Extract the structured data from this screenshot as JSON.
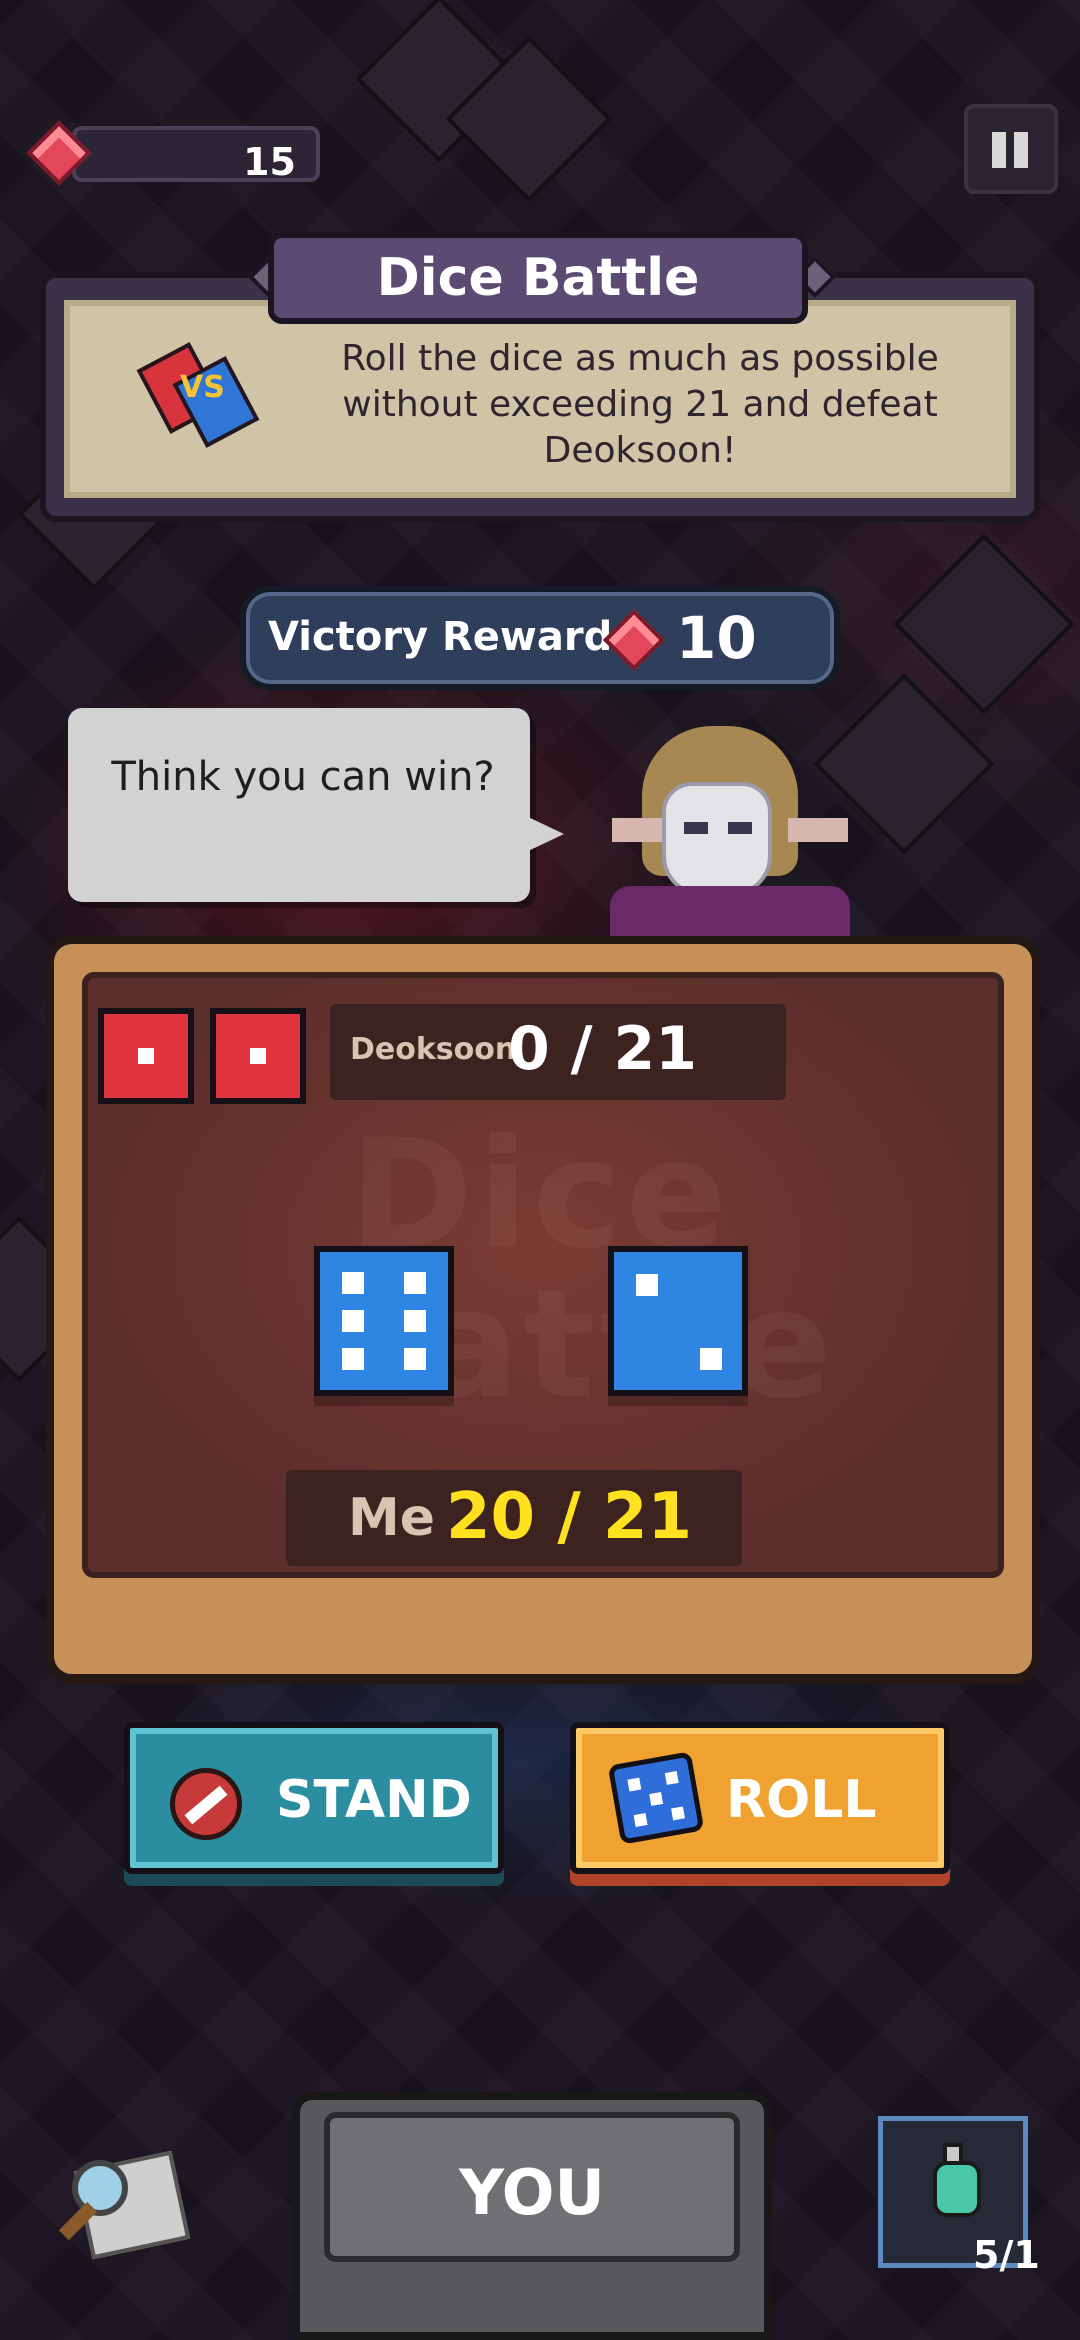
{
  "hud": {
    "gem_count": "15",
    "gem_icon": "red-gem-icon",
    "pause_icon": "pause-icon"
  },
  "panel": {
    "title": "Dice Battle",
    "description": "Roll the dice as much as possible without exceeding 21 and defeat Deoksoon!",
    "vs_icon": "vs-cards-icon"
  },
  "reward": {
    "label": "Victory Reward",
    "value": "10"
  },
  "opponent": {
    "speech": "Think you can win?",
    "name": "Deoksoon",
    "score": "0 / 21",
    "dice": [
      1,
      1
    ]
  },
  "player": {
    "name": "Me",
    "score": "20 / 21",
    "dice": [
      6,
      2
    ]
  },
  "board": {
    "watermark": "Dice Battle"
  },
  "actions": {
    "stand_label": "STAND",
    "roll_label": "ROLL"
  },
  "bottom": {
    "turn_label": "YOU",
    "potion_count": "5/1"
  },
  "colors": {
    "gem": "#e2485a",
    "opponent_die": "#e0353e",
    "player_die": "#2f86e2",
    "stand_button": "#2b8ea0",
    "roll_button": "#f0a230",
    "my_score": "#ffe11f"
  }
}
